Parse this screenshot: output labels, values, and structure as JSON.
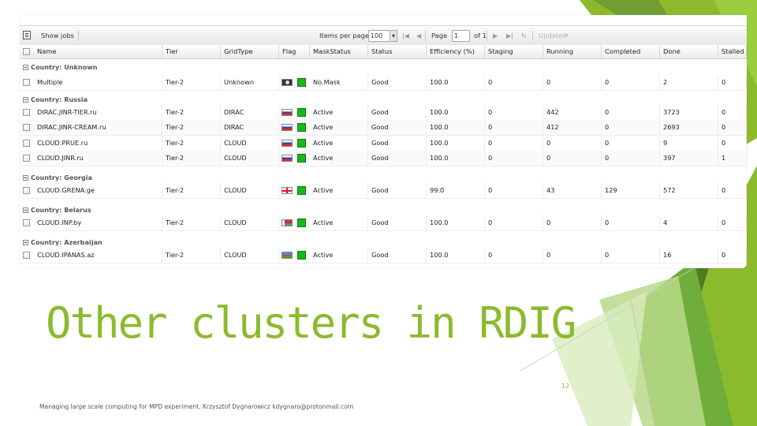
{
  "toolbar": {
    "show_jobs_label": "Show jobs",
    "items_per_page_label": "Items per page:",
    "items_per_page_value": "100",
    "page_label": "Page",
    "page_value": "1",
    "of_pages": "of 1",
    "updated_label": "Updated"
  },
  "columns": [
    "Name",
    "Tier",
    "GridType",
    "Flag",
    "MaskStatus",
    "Status",
    "Efficiency (%)",
    "Staging",
    "Running",
    "Completed",
    "Done",
    "Stalled"
  ],
  "groups": [
    {
      "label": "Country: Unknown",
      "rows": [
        {
          "name": "Multiple",
          "tier": "Tier-2",
          "gridtype": "Unknown",
          "flag": "unknown",
          "mask": "No.Mask",
          "status": "Good",
          "efficiency": "100.0",
          "staging": "0",
          "running": "0",
          "completed": "0",
          "done": "2",
          "stalled": "0"
        }
      ]
    },
    {
      "label": "Country: Russia",
      "rows": [
        {
          "name": "DIRAC.JINR-TIER.ru",
          "tier": "Tier-2",
          "gridtype": "DIRAC",
          "flag": "russia",
          "mask": "Active",
          "status": "Good",
          "efficiency": "100.0",
          "staging": "0",
          "running": "442",
          "completed": "0",
          "done": "3723",
          "stalled": "0"
        },
        {
          "name": "DIRAC.JINR-CREAM.ru",
          "tier": "Tier-2",
          "gridtype": "DIRAC",
          "flag": "russia",
          "mask": "Active",
          "status": "Good",
          "efficiency": "100.0",
          "staging": "0",
          "running": "412",
          "completed": "0",
          "done": "2693",
          "stalled": "0"
        },
        {
          "name": "CLOUD.PRUE.ru",
          "tier": "Tier-2",
          "gridtype": "CLOUD",
          "flag": "russia",
          "mask": "Active",
          "status": "Good",
          "efficiency": "100.0",
          "staging": "0",
          "running": "0",
          "completed": "0",
          "done": "9",
          "stalled": "0"
        },
        {
          "name": "CLOUD.JINR.ru",
          "tier": "Tier-2",
          "gridtype": "CLOUD",
          "flag": "russia",
          "mask": "Active",
          "status": "Good",
          "efficiency": "100.0",
          "staging": "0",
          "running": "0",
          "completed": "0",
          "done": "397",
          "stalled": "1"
        }
      ]
    },
    {
      "label": "Country: Georgia",
      "rows": [
        {
          "name": "CLOUD.GRENA.ge",
          "tier": "Tier-2",
          "gridtype": "CLOUD",
          "flag": "georgia",
          "mask": "Active",
          "status": "Good",
          "efficiency": "99.0",
          "staging": "0",
          "running": "43",
          "completed": "129",
          "done": "572",
          "stalled": "0"
        }
      ]
    },
    {
      "label": "Country: Belarus",
      "rows": [
        {
          "name": "CLOUD.INP.by",
          "tier": "Tier-2",
          "gridtype": "CLOUD",
          "flag": "belarus",
          "mask": "Active",
          "status": "Good",
          "efficiency": "100.0",
          "staging": "0",
          "running": "0",
          "completed": "0",
          "done": "4",
          "stalled": "0"
        }
      ]
    },
    {
      "label": "Country: Azerbaijan",
      "rows": [
        {
          "name": "CLOUD.IPANAS.az",
          "tier": "Tier-2",
          "gridtype": "CLOUD",
          "flag": "azerbaijan",
          "mask": "Active",
          "status": "Good",
          "efficiency": "100.0",
          "staging": "0",
          "running": "0",
          "completed": "0",
          "done": "16",
          "stalled": "0"
        }
      ]
    }
  ],
  "colors": {
    "accent": "#8bbb2d",
    "mask_green": "#17b81c"
  },
  "slide": {
    "title": "Other clusters in RDIG",
    "page_number": "12",
    "footer": "Managing large scale computing for MPD experiment, Krzysztof Dygnarowicz kdygnaro@protonmail.com"
  }
}
